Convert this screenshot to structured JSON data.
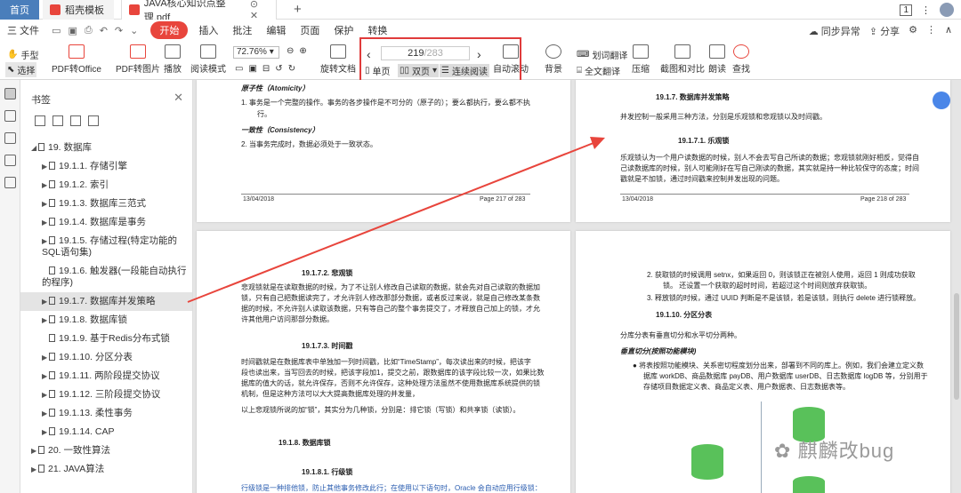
{
  "titlebar": {
    "home": "首页",
    "tab1": "稻壳模板",
    "tab2": "JAVA核心知识点整理.pdf",
    "tab2_icon_color": "#e8453c",
    "tab1_icon_color": "#e8453c",
    "page_badge": "1"
  },
  "menubar": {
    "file": "三 文件",
    "start": "开始",
    "items": [
      "插入",
      "批注",
      "编辑",
      "页面",
      "保护",
      "转换"
    ],
    "sync": "同步异常",
    "share": "分享"
  },
  "ribbon": {
    "hand": "手型",
    "select": "选择",
    "pdf_office": "PDF转Office",
    "pdf_img": "PDF转图片",
    "play": "播放",
    "read_mode": "阅读模式",
    "zoom": "72.76%",
    "rotate": "旋转文档",
    "page_current": "219",
    "page_total": "/283",
    "single": "单页",
    "double": "双页",
    "continuous": "连续阅读",
    "autoscroll": "自动滚动",
    "bg": "背景",
    "word_translate": "划词翻译",
    "full_translate": "全文翻译",
    "compress": "压缩",
    "compare": "截图和对比",
    "read": "朗读",
    "search": "查找"
  },
  "sidebar": {
    "title": "书签",
    "items": [
      {
        "label": "19. 数据库",
        "level": 0,
        "arrow": "◢"
      },
      {
        "label": "19.1.1. 存储引擎",
        "level": 1,
        "arrow": "▶"
      },
      {
        "label": "19.1.2. 索引",
        "level": 1,
        "arrow": "▶"
      },
      {
        "label": "19.1.3. 数据库三范式",
        "level": 1,
        "arrow": "▶"
      },
      {
        "label": "19.1.4. 数据库是事务",
        "level": 1,
        "arrow": "▶"
      },
      {
        "label": "19.1.5. 存储过程(特定功能的SQL语句集)",
        "level": 1,
        "arrow": "▶"
      },
      {
        "label": "19.1.6. 触发器(一段能自动执行的程序)",
        "level": 1,
        "arrow": ""
      },
      {
        "label": "19.1.7. 数据库并发策略",
        "level": 1,
        "arrow": "▶",
        "active": true
      },
      {
        "label": "19.1.8. 数据库锁",
        "level": 1,
        "arrow": "▶"
      },
      {
        "label": "19.1.9. 基于Redis分布式锁",
        "level": 1,
        "arrow": ""
      },
      {
        "label": "19.1.10. 分区分表",
        "level": 1,
        "arrow": "▶"
      },
      {
        "label": "19.1.11. 两阶段提交协议",
        "level": 1,
        "arrow": "▶"
      },
      {
        "label": "19.1.12. 三阶段提交协议",
        "level": 1,
        "arrow": "▶"
      },
      {
        "label": "19.1.13. 柔性事务",
        "level": 1,
        "arrow": "▶"
      },
      {
        "label": "19.1.14. CAP",
        "level": 1,
        "arrow": "▶"
      },
      {
        "label": "20. 一致性算法",
        "level": 0,
        "arrow": "▶"
      },
      {
        "label": "21. JAVA算法",
        "level": 0,
        "arrow": "▶"
      }
    ]
  },
  "pages": {
    "p1": {
      "h_atom": "原子性（Atomicity）",
      "atom_1": "1.   事务是一个完整的操作。事务的各步操作是不可分的（原子的）；要么都执行，要么都不执",
      "atom_1b": "行。",
      "h_cons": "一致性（Consistency）",
      "cons_2": "2.   当事务完成时，数据必须处于一致状态。",
      "date": "13/04/2018",
      "pageno": "Page 217 of 283"
    },
    "p2": {
      "h1": "19.1.7.   数据库并发策略",
      "intro": "并发控制一般采用三种方法，分别是乐观锁和悲观锁以及时间戳。",
      "h2": "19.1.7.1.   乐观锁",
      "l1": "乐观锁认为一个用户读数据的时候，别人不会去写自己所读的数据；悲观锁就刚好相反，觉得自",
      "l2": "己读数据库的时候，别人可能刚好在写自己刚读的数据，其实就是持一种比较保守的态度；时间",
      "l3": "戳就是不加锁，通过时间戳来控制并发出现的问题。",
      "date": "13/04/2018",
      "pageno": "Page 218 of 283"
    },
    "p3": {
      "h1": "19.1.7.2.   悲观锁",
      "l1": "悲观锁就是在读取数据的时候，为了不让别人修改自己读取的数据，就会先对自己读取的数据加",
      "l2": "锁，只有自己把数据读完了，才允许别人修改那部分数据，或者反过来说，就是自己修改某条数",
      "l3": "据的时候，不允许别人读取该数据，只有等自己的整个事务提交了，才释放自己加上的锁，才允",
      "l4": "许其他用户访问那部分数据。",
      "h2": "19.1.7.3.   时间戳",
      "t1": "时间戳就是在数据库表中单独加一列时间戳，比如“TimeStamp”，每次读出来的时候，把该字",
      "t2": "段也读出来，当写回去的时候，把该字段加1，提交之前，跟数据库的该字段比较一次，如果比数",
      "t3": "据库的值大的话，就允许保存，否则不允许保存，这种处理方法虽然不使用数据库系统提供的锁",
      "t4": "机制，但是这种方法可以大大提高数据库处理的并发量，",
      "t5": "以上悲观锁所说的加“锁”，其实分为几种锁，分别是：排它锁（写锁）和共享锁（读锁）。",
      "h3": "19.1.8.   数据库锁",
      "h4": "19.1.8.1.   行级锁",
      "t6": "行级锁是一种排他锁，防止其他事务修改此行；在使用以下语句时，Oracle 会自动应用行级锁："
    },
    "p4": {
      "a1": "2.   获取锁的时候调用 setnx，如果返回 0，则该锁正在被别人使用，返回 1 则成功获取",
      "a1b": "锁。 还设置一个获取的超时时间，若超过这个时间则放弃获取锁。",
      "a2": "3.   释放锁的时候，通过 UUID 判断是不是该锁，若是该锁，则执行 delete 进行锁释放。",
      "h1": "19.1.10.   分区分表",
      "intro": "分库分表有垂直切分和水平切分两种。",
      "h2": "垂直切分(按照功能模块)",
      "b1": "●  将表按照功能模块、关系密切程度划分出来，部署到不同的库上。例如，我们会建立定义数",
      "b2": "据库 workDB、商品数据库 payDB、用户数据库 userDB、日志数据库 logDB 等，分别用于",
      "b3": "存储项目数据定义表、商品定义表、用户数据表、日志数据表等。"
    }
  },
  "watermark": "麒麟改bug",
  "colors": {
    "accent_red": "#e8453c",
    "home_blue": "#4a7ebb",
    "db_green": "#59c15a",
    "link_blue": "#2a5db0"
  }
}
